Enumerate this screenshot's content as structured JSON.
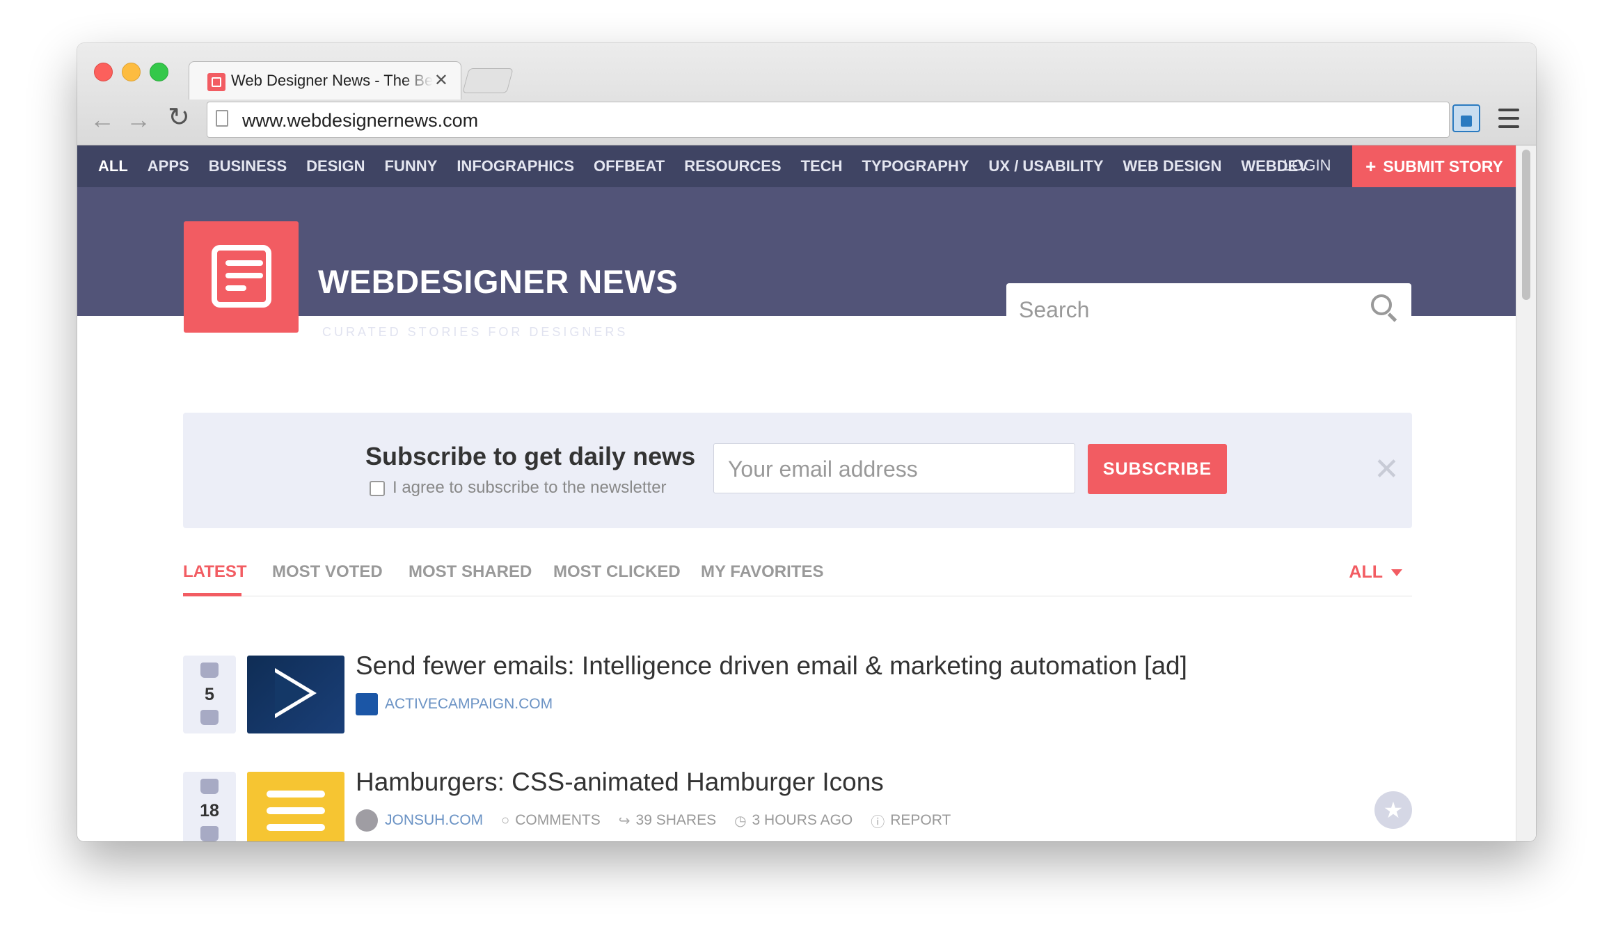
{
  "browser": {
    "tab_title": "Web Designer News - The Best Curated Web Design & Web Development News",
    "tab_close": "✕",
    "url": "www.webdesignernews.com",
    "back": "←",
    "forward": "→",
    "reload": "C"
  },
  "topnav": {
    "items": [
      "ALL",
      "APPS",
      "BUSINESS",
      "DESIGN",
      "FUNNY",
      "INFOGRAPHICS",
      "OFFBEAT",
      "RESOURCES",
      "TECH",
      "TYPOGRAPHY",
      "UX / USABILITY",
      "WEB DESIGN",
      "WEBDEV"
    ],
    "login": "LOGIN",
    "submit_plus": "+",
    "submit": "SUBMIT STORY"
  },
  "header": {
    "brand": "WEBDESIGNER NEWS",
    "tagline": "CURATED STORIES FOR DESIGNERS",
    "search_placeholder": "Search"
  },
  "subscribe": {
    "title": "Subscribe to get daily news",
    "checkbox_label": "I agree to subscribe to the newsletter",
    "email_placeholder": "Your email address",
    "button": "SUBSCRIBE",
    "close": "✕"
  },
  "tabs": {
    "items": [
      "LATEST",
      "MOST VOTED",
      "MOST SHARED",
      "MOST CLICKED",
      "MY FAVORITES"
    ],
    "filter": "ALL"
  },
  "stories": [
    {
      "votes": "5",
      "title": "Send fewer emails: Intelligence driven email & marketing automation [ad]",
      "source": "ACTIVECAMPAIGN.COM"
    },
    {
      "votes": "18",
      "title": "Hamburgers: CSS-animated Hamburger Icons",
      "source": "JONSUH.COM",
      "comments": "COMMENTS",
      "shares": "39 SHARES",
      "time": "3 HOURS AGO",
      "report": "REPORT",
      "star": "★"
    }
  ],
  "colors": {
    "accent": "#f25c62",
    "nav_bg": "#3f4463",
    "hero_bg": "#525478",
    "panel_bg": "#eceef7"
  }
}
